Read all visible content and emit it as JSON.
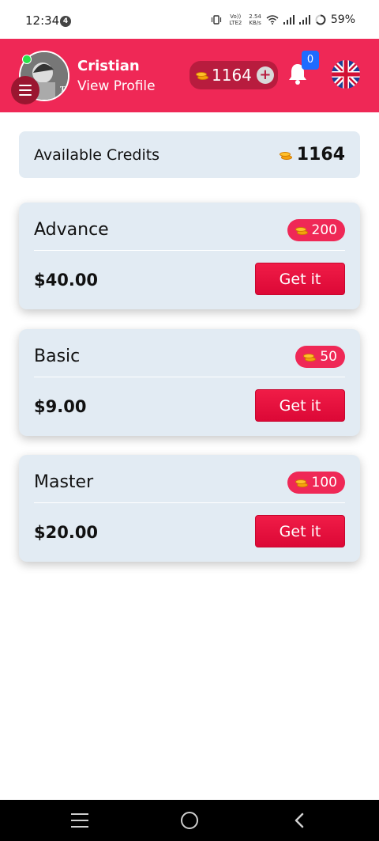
{
  "status_bar": {
    "time": "12:34",
    "notification_count": "4",
    "network_label": "Vo)) LTE2",
    "speed": "2.54",
    "speed_unit": "KB/s",
    "battery": "59%"
  },
  "header": {
    "user_name": "Cristian",
    "view_profile_label": "View Profile",
    "credits": "1164",
    "add_label": "+",
    "notification_count": "0",
    "avatar_text": "TRUN"
  },
  "available": {
    "label": "Available Credits",
    "value": "1164"
  },
  "packages": [
    {
      "name": "Advance",
      "credits": "200",
      "price": "$40.00",
      "button": "Get it"
    },
    {
      "name": "Basic",
      "credits": "50",
      "price": "$9.00",
      "button": "Get it"
    },
    {
      "name": "Master",
      "credits": "100",
      "price": "$20.00",
      "button": "Get it"
    }
  ],
  "icons": {
    "coin": "coin-icon",
    "bell": "bell-icon",
    "flag": "uk-flag-icon",
    "menu": "menu-icon"
  },
  "colors": {
    "brand": "#ef2856",
    "card_bg": "#e2ebf3",
    "badge_blue": "#1e6bff"
  }
}
